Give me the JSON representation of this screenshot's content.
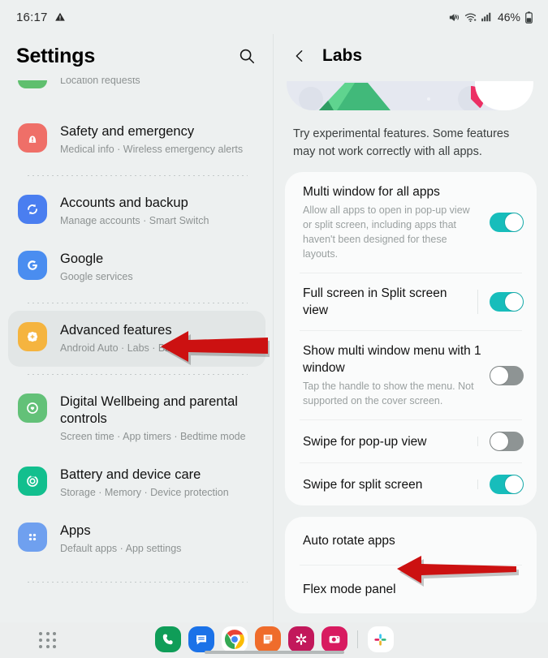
{
  "status_bar": {
    "time": "16:17",
    "warning_icon": "warning-triangle-icon",
    "mute_icon": "volume-mute-icon",
    "wifi_icon": "wifi-icon",
    "signal_icon": "cellular-signal-icon",
    "battery_percent": "46%",
    "battery_icon": "battery-icon"
  },
  "left_pane": {
    "title": "Settings",
    "search_icon": "search-icon",
    "items": [
      {
        "title": "",
        "subtitle": "Location requests",
        "icon": "location-icon",
        "icon_color": "#5fbf6e",
        "clipped": true,
        "selected": false
      },
      {
        "title": "Safety and emergency",
        "subtitle": "Medical info  ·  Wireless emergency alerts",
        "icon": "emergency-siren-icon",
        "icon_color": "#ef6f68",
        "clipped": false,
        "selected": false
      },
      {
        "title": "Accounts and backup",
        "subtitle": "Manage accounts  ·  Smart Switch",
        "icon": "sync-accounts-icon",
        "icon_color": "#4a7ef0",
        "clipped": false,
        "selected": false
      },
      {
        "title": "Google",
        "subtitle": "Google services",
        "icon": "google-g-icon",
        "icon_color": "#4a8df0",
        "clipped": false,
        "selected": false
      },
      {
        "title": "Advanced features",
        "subtitle": "Android Auto  ·  Labs  ·  Bixby Routines",
        "icon": "gear-flower-icon",
        "icon_color": "#f5b43f",
        "clipped": false,
        "selected": true
      },
      {
        "title": "Digital Wellbeing and parental controls",
        "subtitle": "Screen time  ·  App timers  ·  Bedtime mode",
        "icon": "wellbeing-heart-icon",
        "icon_color": "#63c178",
        "clipped": false,
        "selected": false
      },
      {
        "title": "Battery and device care",
        "subtitle": "Storage  ·  Memory  ·  Device protection",
        "icon": "device-care-icon",
        "icon_color": "#12bf8e",
        "clipped": false,
        "selected": false
      },
      {
        "title": "Apps",
        "subtitle": "Default apps  ·  App settings",
        "icon": "apps-grid-icon",
        "icon_color": "#6fa0ef",
        "clipped": false,
        "selected": false
      }
    ]
  },
  "right_pane": {
    "back_icon": "back-chevron-icon",
    "title": "Labs",
    "illustration": "labs-banner-illustration",
    "intro": "Try experimental features. Some features may not work correctly with all apps.",
    "cards": [
      {
        "rows": [
          {
            "name": "Multi window for all apps",
            "desc": "Allow all apps to open in pop-up view or split screen, including apps that haven't been designed for these layouts.",
            "toggle": "on",
            "divider": false
          },
          {
            "name": "Full screen in Split screen view",
            "desc": "",
            "toggle": "on",
            "divider": true
          },
          {
            "name": "Show multi window menu with 1 window",
            "desc": "Tap the handle to show the menu. Not supported on the cover screen.",
            "toggle": "off",
            "divider": false
          },
          {
            "name": "Swipe for pop-up view",
            "desc": "",
            "toggle": "off",
            "divider": true
          },
          {
            "name": "Swipe for split screen",
            "desc": "",
            "toggle": "on",
            "divider": true
          }
        ]
      },
      {
        "rows": [
          {
            "name": "Auto rotate apps",
            "desc": "",
            "toggle": "none",
            "divider": false
          },
          {
            "name": "Flex mode panel",
            "desc": "",
            "toggle": "none",
            "divider": false
          }
        ]
      }
    ]
  },
  "annotations": {
    "color": "#cc1111",
    "arrows": [
      {
        "name": "arrow-advanced-features",
        "target": "Advanced features"
      },
      {
        "name": "arrow-flex-mode-panel",
        "target": "Flex mode panel"
      }
    ]
  },
  "taskbar": {
    "apps_grid_icon": "apps-grid-icon",
    "apps": [
      {
        "label": "Phone",
        "icon": "phone-icon",
        "color": "#0f9d58"
      },
      {
        "label": "Messages",
        "icon": "messages-icon",
        "color": "#1b72e8"
      },
      {
        "label": "Chrome",
        "icon": "chrome-icon",
        "color": "#ffffff"
      },
      {
        "label": "Samsung Notes",
        "icon": "notes-icon",
        "color": "#ef6c2b"
      },
      {
        "label": "Flower app",
        "icon": "flower-asterisk-icon",
        "color": "#c2185b"
      },
      {
        "label": "Camera",
        "icon": "camera-icon",
        "color": "#d81b60"
      }
    ],
    "recent": [
      {
        "label": "Slack",
        "icon": "slack-icon",
        "color": "#ffffff"
      }
    ],
    "home_indicator": "home-indicator"
  }
}
